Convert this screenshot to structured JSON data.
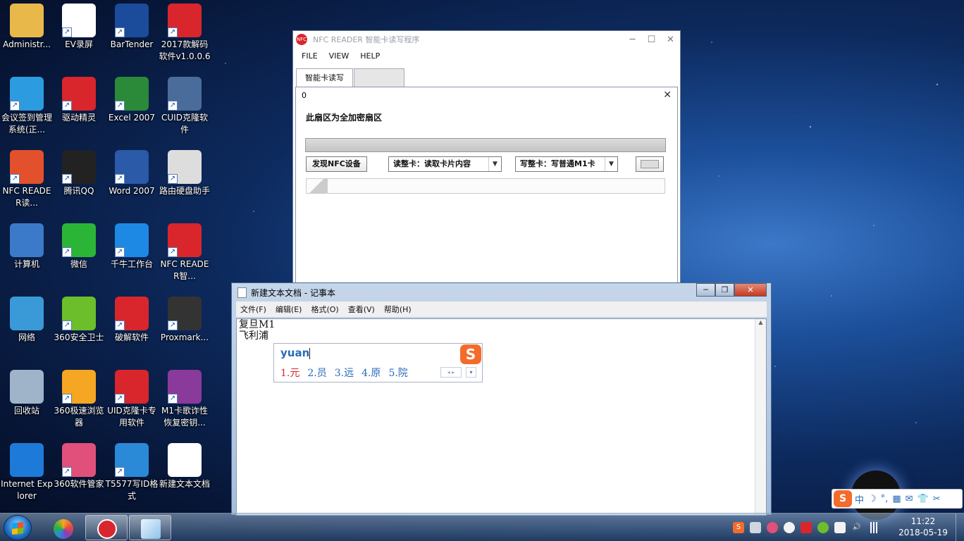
{
  "desktop": {
    "icons": [
      {
        "label": "Administr...",
        "icon": "user-folder-icon",
        "color": "#e8b84a"
      },
      {
        "label": "EV录屏",
        "icon": "ev-recorder-icon",
        "color": "#ffffff"
      },
      {
        "label": "BarTender",
        "icon": "bartender-icon",
        "color": "#1b4b9b"
      },
      {
        "label": "2017款解码软件v1.0.0.6",
        "icon": "decoder-cd-icon",
        "color": "#d8262c"
      },
      {
        "label": "会议签到管理系统(正...",
        "icon": "meeting-signin-icon",
        "color": "#2d9be0"
      },
      {
        "label": "驱动精灵",
        "icon": "driver-genius-icon",
        "color": "#d8262c"
      },
      {
        "label": "Excel 2007",
        "icon": "excel-icon",
        "color": "#2a8a3a"
      },
      {
        "label": "CUID克隆软件",
        "icon": "monitor-icon",
        "color": "#4a6c9a"
      },
      {
        "label": "NFC READER读...",
        "icon": "shield-nfc-icon",
        "color": "#e2502c"
      },
      {
        "label": "腾讯QQ",
        "icon": "qq-penguin-icon",
        "color": "#222222"
      },
      {
        "label": "Word 2007",
        "icon": "word-icon",
        "color": "#2a5aa8"
      },
      {
        "label": "路由硬盘助手",
        "icon": "router-disk-icon",
        "color": "#dddddd"
      },
      {
        "label": "计算机",
        "icon": "computer-icon",
        "color": "#3a7ac8"
      },
      {
        "label": "微信",
        "icon": "wechat-icon",
        "color": "#2bb536"
      },
      {
        "label": "千牛工作台",
        "icon": "qianniu-icon",
        "color": "#1e88e5"
      },
      {
        "label": "NFC READER智...",
        "icon": "nfc-red-icon",
        "color": "#d8262c"
      },
      {
        "label": "网络",
        "icon": "network-globe-icon",
        "color": "#3a9ad8"
      },
      {
        "label": "360安全卫士",
        "icon": "360-safe-icon",
        "color": "#6cbf2a"
      },
      {
        "label": "破解软件",
        "icon": "acs-icon",
        "color": "#d8262c"
      },
      {
        "label": "Proxmark...",
        "icon": "spy-hat-icon",
        "color": "#333333"
      },
      {
        "label": "回收站",
        "icon": "recycle-bin-icon",
        "color": "#9fb4c8"
      },
      {
        "label": "360极速浏览器",
        "icon": "360-browser-icon",
        "color": "#f5a623"
      },
      {
        "label": "UID克隆卡专用软件",
        "icon": "acs-icon",
        "color": "#d8262c"
      },
      {
        "label": "M1卡歌诈性恢复密钥...",
        "icon": "winrar-icon",
        "color": "#8a3a9a"
      },
      {
        "label": "Internet Explorer",
        "icon": "ie-icon",
        "color": "#1e7ad8"
      },
      {
        "label": "360软件管家",
        "icon": "360-software-icon",
        "color": "#e0507a"
      },
      {
        "label": "T5577写ID格式",
        "icon": "mc-cubes-icon",
        "color": "#2a8ad8"
      },
      {
        "label": "新建文本文档",
        "icon": "text-file-icon",
        "color": "#ffffff"
      }
    ]
  },
  "nfc_window": {
    "title": "NFC READER 智能卡读写程序",
    "app_icon": "NFC",
    "menu": [
      "FILE",
      "VIEW",
      "HELP"
    ],
    "tabs": [
      "智能卡读写",
      ""
    ],
    "panel": {
      "id_text": "0",
      "close": "✕",
      "sector_label": "此扇区为全加密扇区",
      "discover_button": "发现NFC设备",
      "read_combo": "读整卡：读取卡片内容",
      "write_combo": "写整卡：写普通M1卡"
    }
  },
  "notepad": {
    "title": "新建文本文档 - 记事本",
    "menu": [
      "文件(F)",
      "编辑(E)",
      "格式(O)",
      "查看(V)",
      "帮助(H)"
    ],
    "lines": [
      "复旦M1",
      "飞利浦"
    ]
  },
  "ime": {
    "composition": "yuan",
    "logo": "S",
    "candidates": [
      "1.元",
      "2.员",
      "3.远",
      "4.原",
      "5.院"
    ],
    "pager": "◂ ▸",
    "more": "▾"
  },
  "ime_status": {
    "logo": "S",
    "items": [
      "中",
      "☽",
      "°,",
      "▦",
      "✉",
      "👕",
      "✂"
    ]
  },
  "taskbar": {
    "time": "11:22",
    "date": "2018-05-19"
  },
  "colors": {
    "accent_red": "#d8262c",
    "ime_blue": "#2a6ab8",
    "sogou_orange": "#f36c2c"
  }
}
